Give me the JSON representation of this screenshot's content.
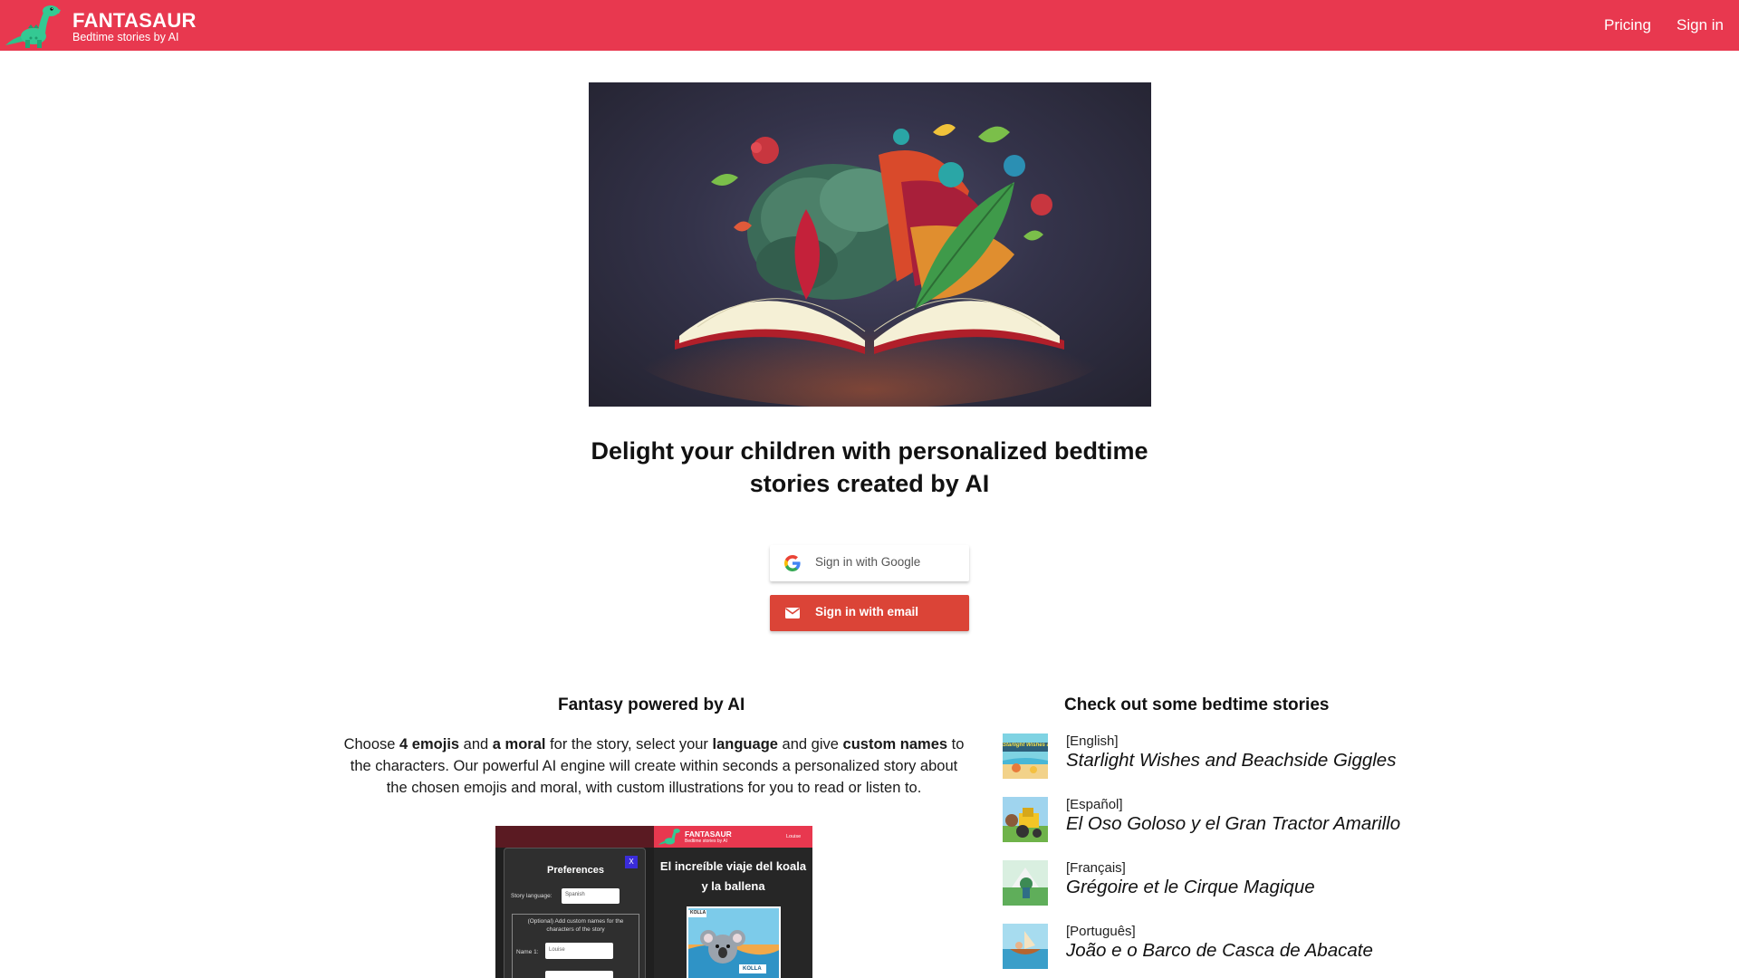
{
  "header": {
    "brand_name": "FANTASAUR",
    "brand_tagline": "Bedtime stories by AI",
    "nav": {
      "pricing": "Pricing",
      "sign_in": "Sign in"
    },
    "bar_color": "#e8384f"
  },
  "hero": {
    "headline": "Delight your children with personalized bedtime stories created by AI"
  },
  "auth": {
    "google_label": "Sign in with Google",
    "email_label": "Sign in with email"
  },
  "features": {
    "title": "Fantasy powered by AI",
    "text_parts": {
      "p1": "Choose ",
      "b1": "4 emojis",
      "p2": " and ",
      "b2": "a moral",
      "p3": " for the story, select your ",
      "b3": "language",
      "p4": " and give ",
      "b4": "custom names",
      "p5": " to the characters. Our powerful AI engine will create within seconds a personalized story about the chosen emojis and moral, with custom illustrations for you to read or listen to."
    },
    "preview": {
      "brand_name": "FANTASAUR",
      "brand_tagline": "Bedtime stories by AI",
      "user_name": "Louise",
      "preferences_title": "Preferences",
      "close_label": "X",
      "story_language_label": "Story language:",
      "story_language_value": "Spanish",
      "optional_text": "(Optional) Add custom names for the characters of the story",
      "name1_label": "Name 1:",
      "name1_value": "Louise",
      "story_title": "El increíble viaje del koala y la ballena",
      "illus_label_top": "KOLLA",
      "illus_label_bottom": "KOLLA"
    }
  },
  "stories": {
    "title": "Check out some bedtime stories",
    "items": [
      {
        "language": "[English]",
        "title": "Starlight Wishes and Beachside Giggles",
        "thumb_text": "Starlight Wishes and Beachside Giggles"
      },
      {
        "language": "[Español]",
        "title": "El Oso Goloso y el Gran Tractor Amarillo"
      },
      {
        "language": "[Français]",
        "title": "Grégoire et le Cirque Magique"
      },
      {
        "language": "[Português]",
        "title": "João e o Barco de Casca de Abacate"
      }
    ]
  }
}
